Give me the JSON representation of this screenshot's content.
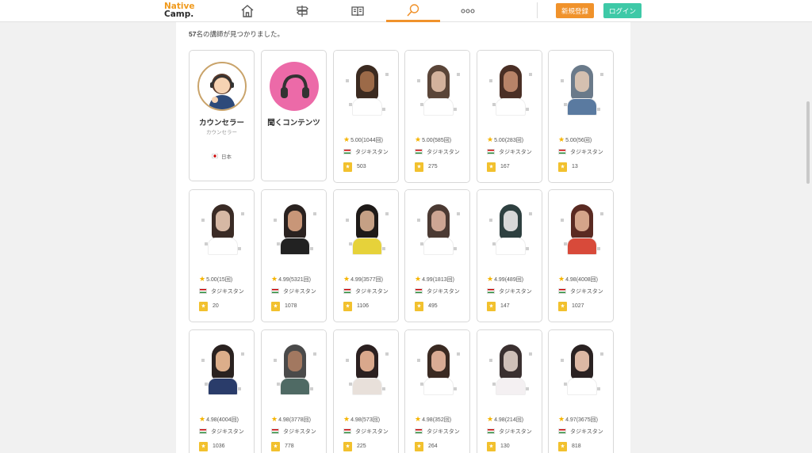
{
  "header": {
    "logo_line1": "Native",
    "logo_line2": "Camp.",
    "nav": [
      {
        "name": "home-icon"
      },
      {
        "name": "signpost-icon"
      },
      {
        "name": "book-icon"
      },
      {
        "name": "search-icon",
        "active": true
      },
      {
        "name": "more-dots-icon"
      }
    ],
    "register_label": "新規登録",
    "login_label": "ログイン"
  },
  "results": {
    "count": "57",
    "suffix": "名の講師が見つかりました。"
  },
  "special_cards": {
    "counselor": {
      "title": "カウンセラー",
      "subtitle": "カウンセラー",
      "country": "日本"
    },
    "listening": {
      "title": "聞くコンテンツ"
    }
  },
  "teachers": [
    {
      "rating": "5.00(1044回)",
      "country": "タジキスタン",
      "favorites": "503"
    },
    {
      "rating": "5.00(585回)",
      "country": "タジキスタン",
      "favorites": "275"
    },
    {
      "rating": "5.00(283回)",
      "country": "タジキスタン",
      "favorites": "167"
    },
    {
      "rating": "5.00(56回)",
      "country": "タジキスタン",
      "favorites": "13"
    },
    {
      "rating": "5.00(15回)",
      "country": "タジキスタン",
      "favorites": "20"
    },
    {
      "rating": "4.99(5321回)",
      "country": "タジキスタン",
      "favorites": "1078"
    },
    {
      "rating": "4.99(3577回)",
      "country": "タジキスタン",
      "favorites": "1106"
    },
    {
      "rating": "4.99(1813回)",
      "country": "タジキスタン",
      "favorites": "495"
    },
    {
      "rating": "4.99(489回)",
      "country": "タジキスタン",
      "favorites": "147"
    },
    {
      "rating": "4.98(4008回)",
      "country": "タジキスタン",
      "favorites": "1027"
    },
    {
      "rating": "4.98(4004回)",
      "country": "タジキスタン",
      "favorites": "1036"
    },
    {
      "rating": "4.98(3778回)",
      "country": "タジキスタン",
      "favorites": "778"
    },
    {
      "rating": "4.98(573回)",
      "country": "タジキスタン",
      "favorites": "225"
    },
    {
      "rating": "4.98(352回)",
      "country": "タジキスタン",
      "favorites": "264"
    },
    {
      "rating": "4.98(214回)",
      "country": "タジキスタン",
      "favorites": "130"
    },
    {
      "rating": "4.97(3675回)",
      "country": "タジキスタン",
      "favorites": "818"
    }
  ]
}
